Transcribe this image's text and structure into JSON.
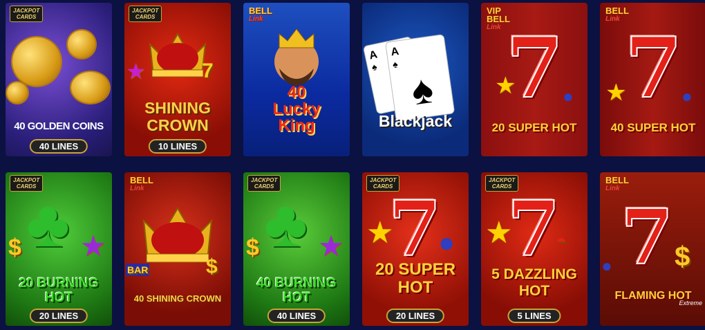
{
  "tiles": [
    {
      "badge": "JACKPOT\nCARDS",
      "title": "40 GOLDEN COINS",
      "lines": "40 LINES"
    },
    {
      "badge": "JACKPOT\nCARDS",
      "title": "SHINING\nCROWN",
      "lines": "10 LINES"
    },
    {
      "badge": "BELL",
      "badge2": "Link",
      "title": "40\nLucky\nKing"
    },
    {
      "title": "Blackjack"
    },
    {
      "badge": "VIP\nBELL",
      "badge2": "Link",
      "title": "20 SUPER HOT"
    },
    {
      "badge": "BELL",
      "badge2": "Link",
      "title": "40 SUPER HOT"
    },
    {
      "badge": "JACKPOT\nCARDS",
      "title": "20 BURNING\nHOT",
      "lines": "20 LINES"
    },
    {
      "badge": "BELL",
      "badge2": "Link",
      "title": "40 SHINING CROWN"
    },
    {
      "badge": "JACKPOT\nCARDS",
      "title": "40 BURNING\nHOT",
      "lines": "40 LINES"
    },
    {
      "badge": "JACKPOT\nCARDS",
      "title": "20 SUPER\nHOT",
      "lines": "20 LINES"
    },
    {
      "badge": "JACKPOT\nCARDS",
      "title": "5 DAZZLING\nHOT",
      "lines": "5 LINES"
    },
    {
      "badge": "BELL",
      "badge2": "Link",
      "title": "FLAMING HOT",
      "title2": "Extreme"
    }
  ],
  "colors": {
    "page_bg": "#0b1140",
    "lines_border": "#c9a43a"
  }
}
